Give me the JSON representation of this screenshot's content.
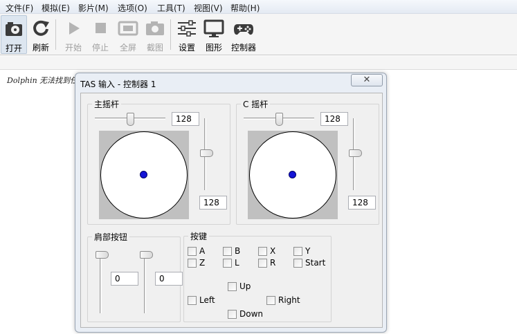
{
  "menu": [
    "文件(F)",
    "模拟(E)",
    "影片(M)",
    "选项(O)",
    "工具(T)",
    "视图(V)",
    "帮助(H)"
  ],
  "toolbar": {
    "open": "打开",
    "refresh": "刷新",
    "play": "开始",
    "stop": "停止",
    "fullscreen": "全屏",
    "screenshot": "截图",
    "settings": "设置",
    "graphics": "图形",
    "controllers": "控制器"
  },
  "background_text": "Dolphin 无法找到任",
  "dialog": {
    "title": "TAS 输入 - 控制器 1",
    "close_glyph": "✕",
    "main_stick": {
      "label": "主摇杆",
      "x": "128",
      "y": "128"
    },
    "c_stick": {
      "label": "C 摇杆",
      "x": "128",
      "y": "128"
    },
    "triggers": {
      "label": "肩部按钮",
      "left": "0",
      "right": "0"
    },
    "buttons": {
      "label": "按键",
      "a": "A",
      "b": "B",
      "x": "X",
      "y": "Y",
      "z": "Z",
      "l": "L",
      "r": "R",
      "start": "Start",
      "up": "Up",
      "left": "Left",
      "right": "Right",
      "down": "Down"
    }
  },
  "colors": {
    "stick_dot": "#1515d6",
    "stick_background": "#c0c0c0"
  }
}
